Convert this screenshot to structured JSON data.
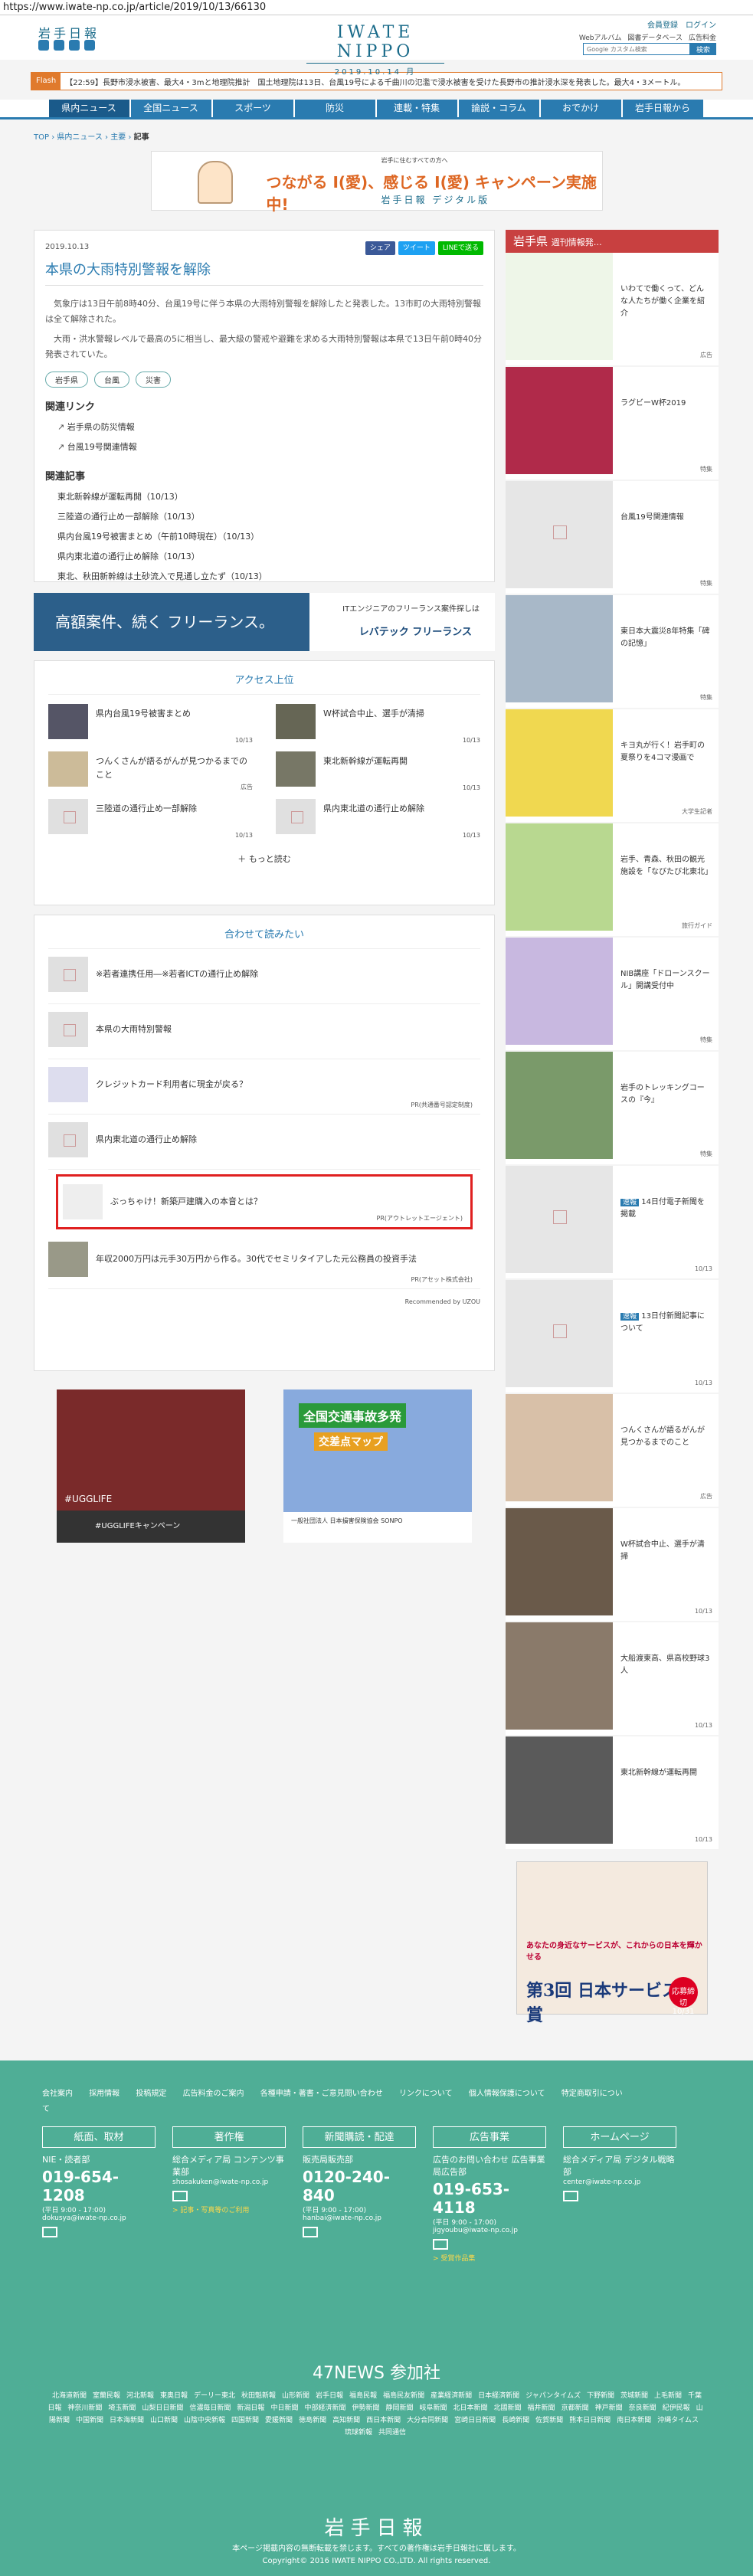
{
  "url": "https://www.iwate-np.co.jp/article/2019/10/13/66130",
  "header": {
    "logo_small": "岩手日報",
    "brand": "IWATE NIPPO",
    "date": "2019.10.14 月",
    "links": "会員登録　ログイン",
    "sub_links": [
      "Webアルバム",
      "図書データベース",
      "広告料金"
    ],
    "search_placeholder": "Google カスタム検索",
    "search_btn": "検索"
  },
  "flash": {
    "tag": "Flash",
    "text": "【22:59】長野市浸水被害、最大4・3mと地理院推計　国土地理院は13日、台風19号による千曲川の氾濫で浸水被害を受けた長野市の推計浸水深を発表した。最大4・3メートル。"
  },
  "nav": [
    "県内ニュース",
    "全国ニュース",
    "スポーツ",
    "防災",
    "連載・特集",
    "論説・コラム",
    "おでかけ",
    "岩手日報から"
  ],
  "breadcrumb": {
    "a": "TOP",
    "b": "県内ニュース",
    "c": "主要",
    "d": "記事"
  },
  "top_banner": {
    "small": "岩手に住むすべての方へ",
    "main": "つながる I(愛)、感じる I(愛) キャンペーン実施中!",
    "sub": "岩手日報 デジタル版"
  },
  "article": {
    "date": "2019.10.13",
    "share": [
      "シェア",
      "ツイート",
      "LINEで送る"
    ],
    "title": "本県の大雨特別警報を解除",
    "p1": "気象庁は13日午前8時40分、台風19号に伴う本県の大雨特別警報を解除したと発表した。13市町の大雨特別警報は全て解除された。",
    "p2": "大雨・洪水警報レベルで最高の5に相当し、最大級の警戒や避難を求める大雨特別警報は本県で13日午前0時40分発表されていた。",
    "tags": [
      "岩手県",
      "台風",
      "災害"
    ],
    "links_title": "関連リンク",
    "links": [
      "岩手県の防災情報",
      "台風19号関連情報"
    ],
    "related_title": "関連記事",
    "related": [
      "東北新幹線が運転再開（10/13）",
      "三陸道の通行止め一部解除（10/13）",
      "県内台風19号被害まとめ（午前10時現在）（10/13）",
      "県内東北道の通行止め解除（10/13）",
      "東北、秋田新幹線は土砂流入で見通し立たず（10/13）"
    ]
  },
  "ad_levtech": {
    "left": "高額案件、続く フリーランス。",
    "right_small": "ITエンジニアのフリーランス案件探しは",
    "right": "レバテック フリーランス",
    "label": "広告"
  },
  "ranking": {
    "title": "アクセス上位",
    "items": [
      {
        "t": "県内台風19号被害まとめ",
        "d": "10/13"
      },
      {
        "t": "W杯試合中止、選手が清掃",
        "d": "10/13"
      },
      {
        "t": "つんくさんが語るがんが見つかるまでのこと",
        "d": "広告"
      },
      {
        "t": "東北新幹線が運転再開",
        "d": "10/13"
      },
      {
        "t": "三陸道の通行止め一部解除",
        "d": "10/13"
      },
      {
        "t": "県内東北道の通行止め解除",
        "d": "10/13"
      }
    ],
    "more": "もっと読む"
  },
  "recommend": {
    "title": "合わせて読みたい",
    "items": [
      {
        "t": "※若者連携任用―※若者ICTの通行止め解除",
        "pr": ""
      },
      {
        "t": "本県の大雨特別警報",
        "pr": ""
      },
      {
        "t": "クレジットカード利用者に現金が戻る？",
        "pr": "PR(共通番号認定制度)"
      },
      {
        "t": "県内東北道の通行止め解除",
        "pr": ""
      },
      {
        "t": "ぶっちゃけ！新築戸建購入の本音とは？",
        "pr": "PR(アウトレットエージェント)"
      },
      {
        "t": "年収2000万円は元手30万円から作る。30代でセミリタイアした元公務員の投資手法",
        "pr": "PR(アセット株式会社)"
      }
    ],
    "powered": "Recommended by UZOU"
  },
  "ad_ugg": {
    "tagline": "#UGGLIFE",
    "bottom": "#UGGLIFEキャンペーン"
  },
  "ad_map": {
    "t1": "全国交通事故多発",
    "t2": "交差点マップ",
    "bottom": "一般社団法人 日本損害保険協会  SONPO"
  },
  "side": {
    "head": "岩手県",
    "head_sub": "週刊情報発…",
    "items": [
      {
        "t": "いわてで働くって、どんな人たちが働く企業を紹介",
        "src": "広告",
        "new": ""
      },
      {
        "t": "ラグビーW杯2019",
        "src": "特集",
        "new": ""
      },
      {
        "t": "台風19号関連情報",
        "src": "特集",
        "new": ""
      },
      {
        "t": "東日本大震災8年特集「碑の記憶」",
        "src": "特集",
        "new": ""
      },
      {
        "t": "キヨ丸が行く！岩手町の夏祭りを4コマ漫画で",
        "src": "大学生記者",
        "new": ""
      },
      {
        "t": "岩手、青森、秋田の観光施設を「なびたび北東北」",
        "src": "旅行ガイド",
        "new": ""
      },
      {
        "t": "NIB講座「ドローンスクール」開講受付中",
        "src": "特集",
        "new": ""
      },
      {
        "t": "岩手のトレッキングコースの『今』",
        "src": "特集",
        "new": ""
      },
      {
        "t": "14日付電子新聞を掲載",
        "src": "10/13",
        "new": "速報"
      },
      {
        "t": "13日付新聞記事について",
        "src": "10/13",
        "new": "速報"
      },
      {
        "t": "つんくさんが語るがんが見つかるまでのこと",
        "src": "広告",
        "new": ""
      },
      {
        "t": "W杯試合中止、選手が清掃",
        "src": "10/13",
        "new": ""
      },
      {
        "t": "大船渡東高、県高校野球3人",
        "src": "10/13",
        "new": ""
      },
      {
        "t": "東北新幹線が運転再開",
        "src": "10/13",
        "new": ""
      }
    ],
    "award": {
      "t1": "あなたの身近なサービスが、これからの日本を輝かせる",
      "t2": "第3回 日本サービス大賞",
      "t3": "応募締切10/31"
    }
  },
  "footer": {
    "links": [
      "会社案内",
      "採用情報",
      "投稿規定",
      "広告料金のご案内",
      "各種申請・著書・ご意見問い合わせ",
      "リンクについて",
      "個人情報保護について",
      "特定商取引について"
    ],
    "cols": [
      {
        "hd": "紙面、取材",
        "x": "NIE・読者部",
        "tel": "019-654-1208",
        "s": "(平日 9:00 - 17:00)",
        "mail": "dokusya@iwate-np.co.jp",
        "y": ""
      },
      {
        "hd": "著作権",
        "x": "総合メディア局 コンテンツ事業部",
        "tel": "",
        "s": "",
        "mail": "shosakuken@iwate-np.co.jp",
        "y": "> 記事・写真等のご利用"
      },
      {
        "hd": "新聞購読・配達",
        "x": "販売局販売部",
        "tel": "0120-240-840",
        "s": "(平日 9:00 - 17:00)",
        "mail": "hanbai@iwate-np.co.jp",
        "y": ""
      },
      {
        "hd": "広告事業",
        "x": "広告のお問い合わせ 広告事業局広告部",
        "tel": "019-653-4118",
        "s": "(平日 9:00 - 17:00)",
        "mail": "jigyoubu@iwate-np.co.jp",
        "y": "> 受賞作品集"
      },
      {
        "hd": "ホームページ",
        "x": "総合メディア局 デジタル戦略部",
        "tel": "",
        "s": "",
        "mail": "center@iwate-np.co.jp",
        "y": ""
      }
    ],
    "news47": "47NEWS 参加社",
    "papers": [
      "北海道新聞",
      "室蘭民報",
      "河北新報",
      "東奥日報",
      "デーリー東北",
      "秋田魁新報",
      "山形新聞",
      "岩手日報",
      "福島民報",
      "福島民友新聞",
      "産業経済新聞",
      "日本経済新聞",
      "ジャパンタイムズ",
      "下野新聞",
      "茨城新聞",
      "上毛新聞",
      "千葉日報",
      "神奈川新聞",
      "埼玉新聞",
      "山梨日日新聞",
      "信濃毎日新聞",
      "新潟日報",
      "中日新聞",
      "中部経済新聞",
      "伊勢新聞",
      "静岡新聞",
      "岐阜新聞",
      "北日本新聞",
      "北國新聞",
      "福井新聞",
      "京都新聞",
      "神戸新聞",
      "奈良新聞",
      "紀伊民報",
      "山陽新聞",
      "中国新聞",
      "日本海新聞",
      "山口新聞",
      "山陰中央新報",
      "四国新聞",
      "愛媛新聞",
      "徳島新聞",
      "高知新聞",
      "西日本新聞",
      "大分合同新聞",
      "宮崎日日新聞",
      "長崎新聞",
      "佐賀新聞",
      "熊本日日新聞",
      "南日本新聞",
      "沖縄タイムス",
      "琉球新報",
      "共同通信"
    ],
    "logo": "岩手日報",
    "copy1": "本ページ掲載内容の無断転載を禁じます。すべての著作権は岩手日報社に属します。",
    "copy2": "Copyright© 2016 IWATE NIPPO CO.,LTD. All rights reserved."
  }
}
